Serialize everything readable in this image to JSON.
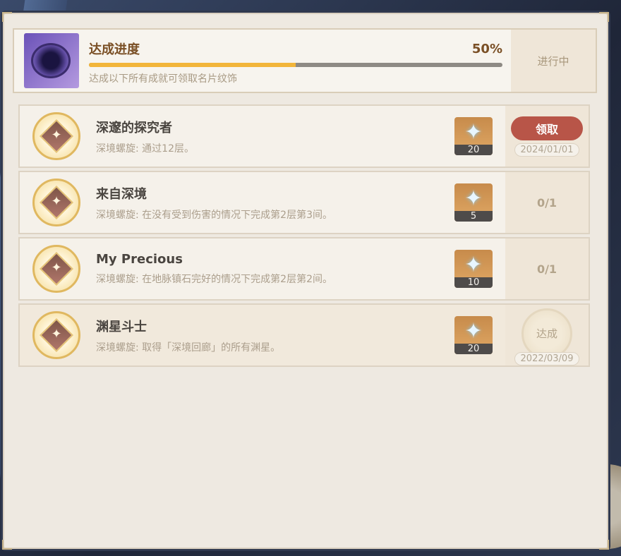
{
  "progress": {
    "title": "达成进度",
    "percent_label": "50%",
    "percent_value": 50,
    "description": "达成以下所有成就可领取名片纹饰",
    "status": "进行中"
  },
  "achievements": [
    {
      "title": "深邃的探究者",
      "description": "深境螺旋: 通过12层。",
      "reward_count": "20",
      "action_label": "领取",
      "date": "2024/01/01"
    },
    {
      "title": "来自深境",
      "description": "深境螺旋: 在没有受到伤害的情况下完成第2层第3间。",
      "reward_count": "5",
      "progress": "0/1"
    },
    {
      "title": "My Precious",
      "description": "深境螺旋: 在地脉镇石完好的情况下完成第2层第2间。",
      "reward_count": "10",
      "progress": "0/1"
    },
    {
      "title": "渊星斗士",
      "description": "深境螺旋: 取得「深境回廊」的所有渊星。",
      "reward_count": "20",
      "stamp_label": "达成",
      "date": "2022/03/09"
    }
  ],
  "colors": {
    "progress_fill": "#f2b53a",
    "claim_button": "#b85548",
    "title_brown": "#7a4f25"
  },
  "icons": {
    "badge": "achievement-badge-icon",
    "reward": "primogem-icon",
    "namecard": "namecard-icon"
  }
}
